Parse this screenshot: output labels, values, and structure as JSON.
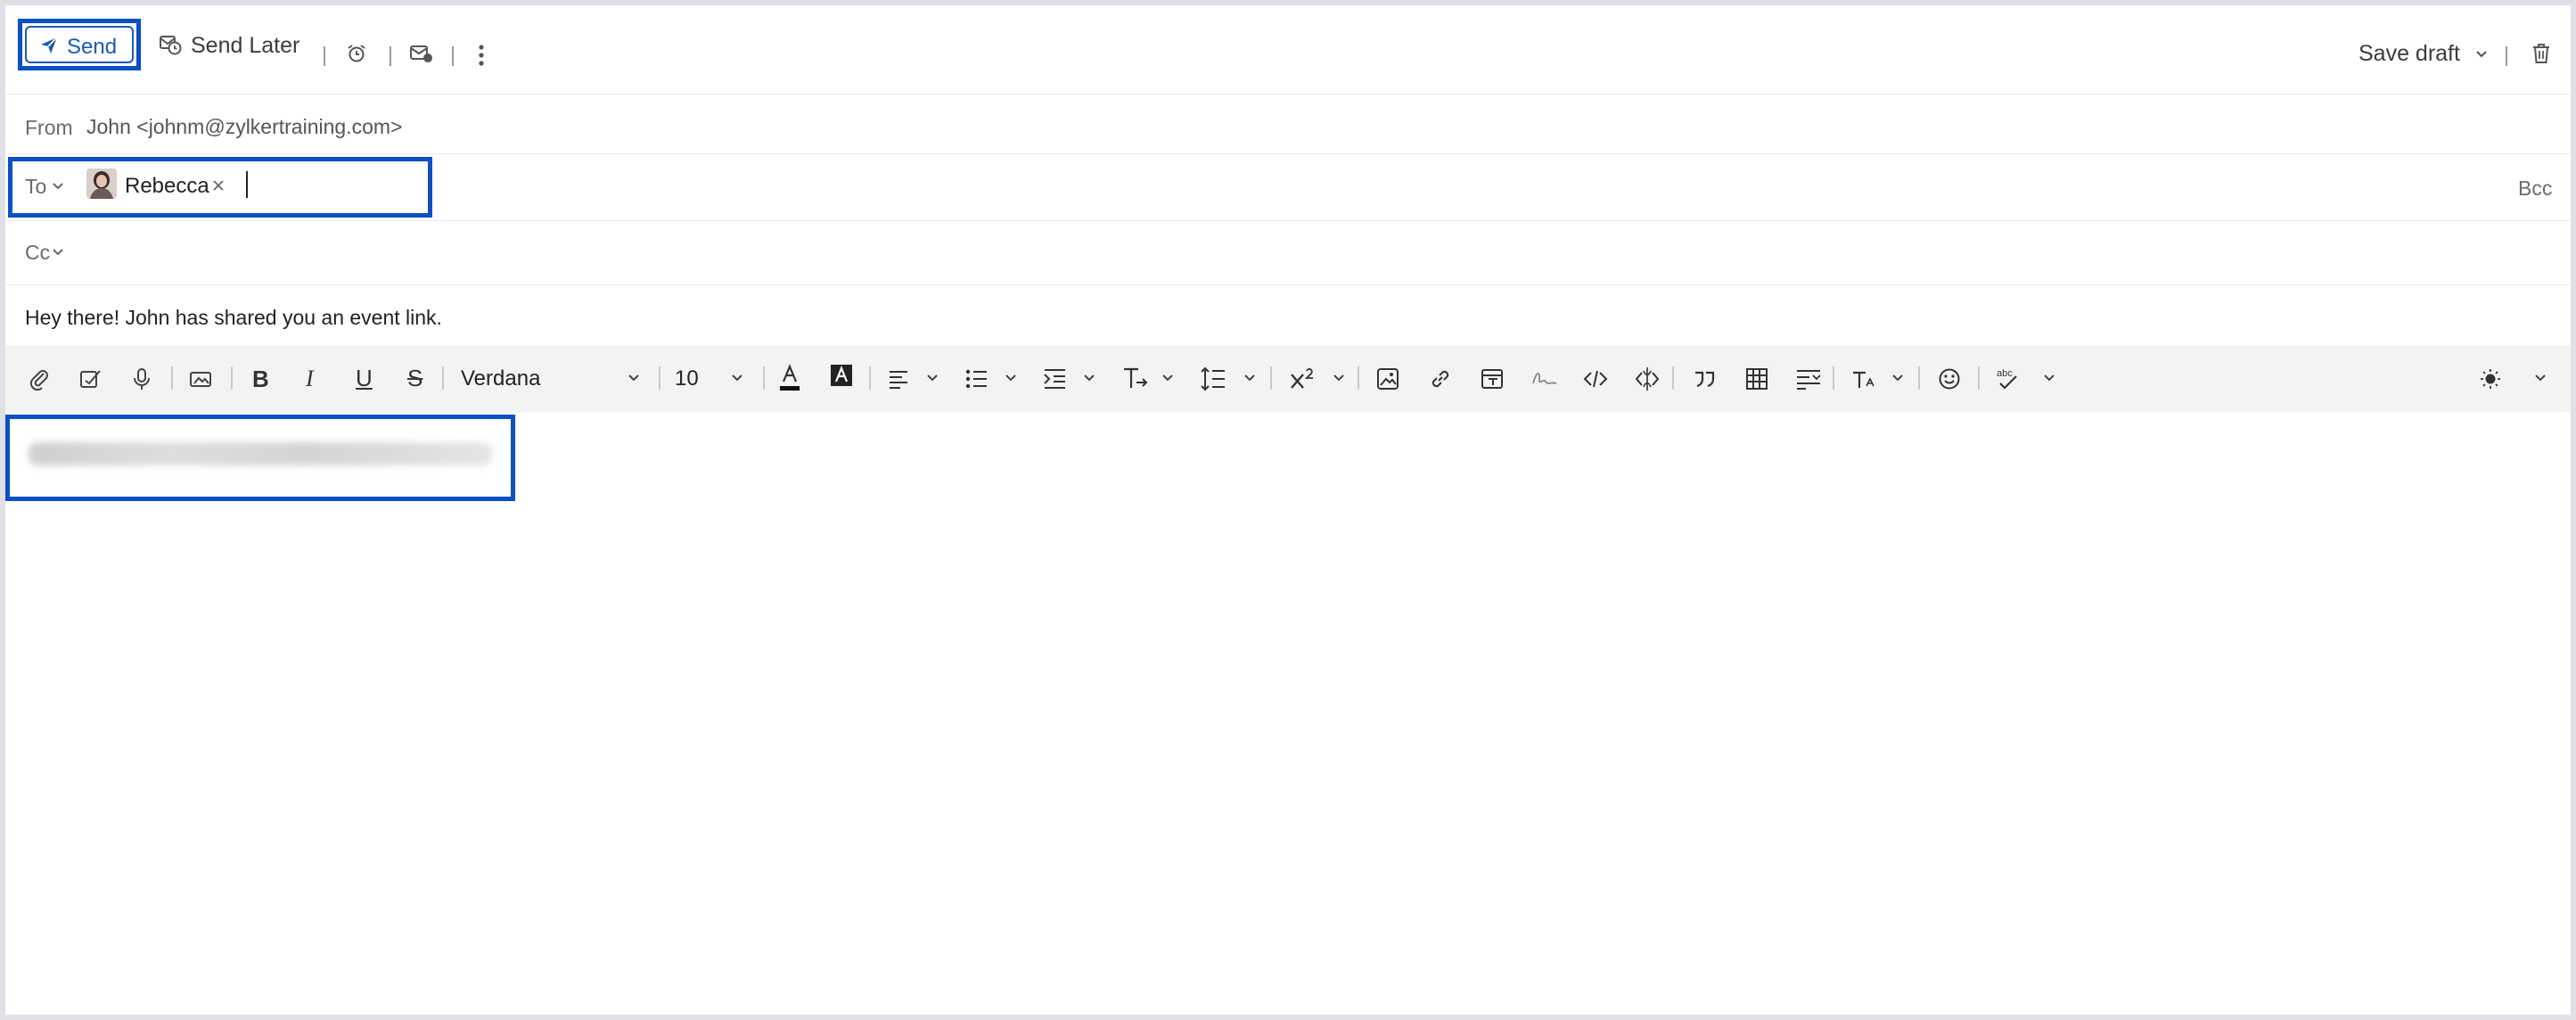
{
  "toolbar": {
    "send_label": "Send",
    "send_later_label": "Send Later",
    "save_draft_label": "Save draft"
  },
  "from": {
    "label": "From",
    "value": "John <johnm@zylkertraining.com>"
  },
  "to": {
    "label": "To",
    "recipients": [
      {
        "name": "Rebecca"
      }
    ]
  },
  "bcc_label": "Bcc",
  "cc": {
    "label": "Cc"
  },
  "subject": "Hey there! John has shared you an event link.",
  "format": {
    "font": "Verdana",
    "size": "10"
  },
  "icons": [
    "send-icon",
    "send-later-icon",
    "reminder-icon",
    "read-receipt-icon",
    "more-icon",
    "save-draft-chevron-icon",
    "delete-icon",
    "attach-icon",
    "signature-icon",
    "microphone-icon",
    "insert-image-icon",
    "bold-icon",
    "italic-icon",
    "underline-icon",
    "strikethrough-icon",
    "font-color-icon",
    "highlight-icon",
    "align-icon",
    "bullet-list-icon",
    "indent-icon",
    "clear-format-icon",
    "line-spacing-icon",
    "superscript-icon",
    "image-icon",
    "link-icon",
    "template-icon",
    "handwriting-icon",
    "code-icon",
    "html-icon",
    "quote-icon",
    "table-icon",
    "text-direction-icon",
    "text-case-icon",
    "emoji-icon",
    "spellcheck-icon",
    "theme-icon"
  ],
  "colors": {
    "accent": "#1f59b6",
    "highlight_outline": "#0b50c4",
    "toolbar_bg": "#f3f3f3"
  }
}
